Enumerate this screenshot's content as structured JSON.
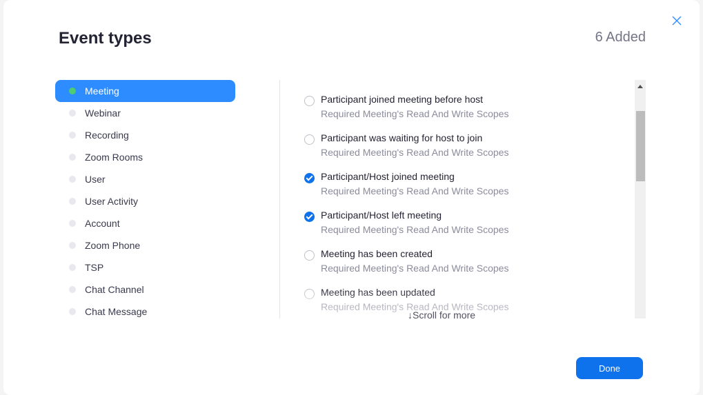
{
  "header": {
    "title": "Event types",
    "added_count": "6 Added",
    "close_icon": "close-icon"
  },
  "colors": {
    "accent": "#2d8cff",
    "button": "#0e72ed",
    "active_dot": "#4fcb72"
  },
  "sidebar": {
    "items": [
      {
        "label": "Meeting",
        "active": true
      },
      {
        "label": "Webinar",
        "active": false
      },
      {
        "label": "Recording",
        "active": false
      },
      {
        "label": "Zoom Rooms",
        "active": false
      },
      {
        "label": "User",
        "active": false
      },
      {
        "label": "User Activity",
        "active": false
      },
      {
        "label": "Account",
        "active": false
      },
      {
        "label": "Zoom Phone",
        "active": false
      },
      {
        "label": "TSP",
        "active": false
      },
      {
        "label": "Chat Channel",
        "active": false
      },
      {
        "label": "Chat Message",
        "active": false
      }
    ]
  },
  "events": [
    {
      "name": "Participant joined meeting before host",
      "scope": "Required Meeting's Read And Write Scopes",
      "checked": false
    },
    {
      "name": "Participant was waiting for host to join",
      "scope": "Required Meeting's Read And Write Scopes",
      "checked": false
    },
    {
      "name": "Participant/Host joined meeting",
      "scope": "Required Meeting's Read And Write Scopes",
      "checked": true
    },
    {
      "name": "Participant/Host left meeting",
      "scope": "Required Meeting's Read And Write Scopes",
      "checked": true
    },
    {
      "name": "Meeting has been created",
      "scope": "Required Meeting's Read And Write Scopes",
      "checked": false
    },
    {
      "name": "Meeting has been updated",
      "scope": "Required Meeting's Read And Write Scopes",
      "checked": false
    }
  ],
  "scroll_hint": "↓Scroll for more",
  "footer": {
    "done_label": "Done"
  }
}
